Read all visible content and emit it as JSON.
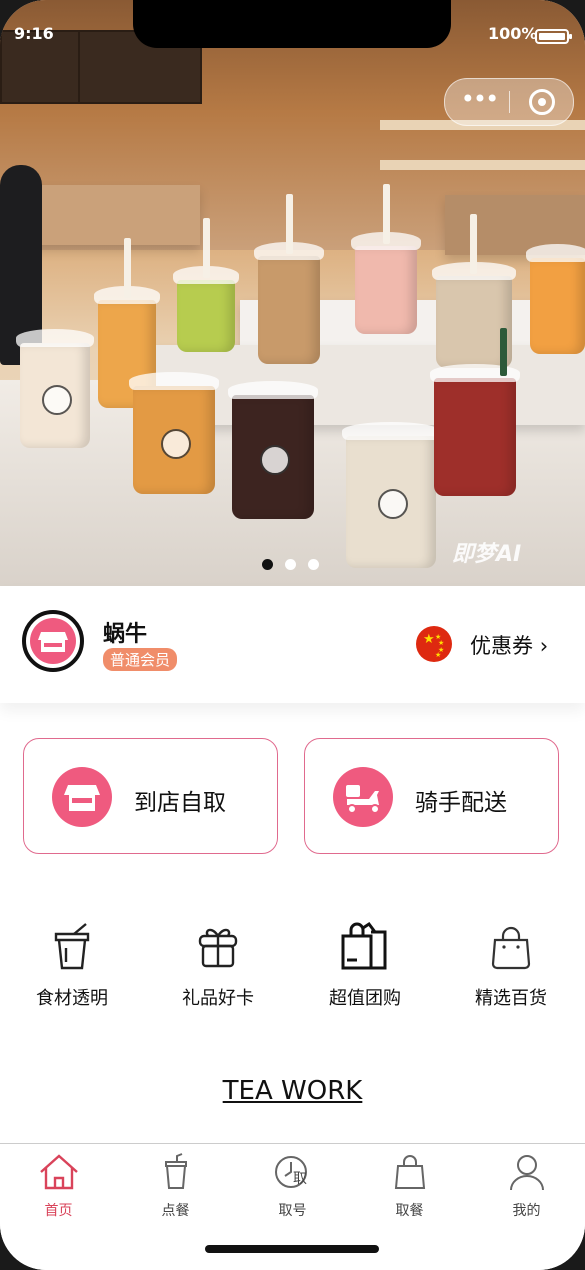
{
  "status_bar": {
    "time": "9:16",
    "battery": "100%",
    "battery_level": 1.0
  },
  "banner": {
    "watermark": "即梦AI",
    "slide_count": 3,
    "active_slide": 1
  },
  "member": {
    "name": "蜗牛",
    "level": "普通会员",
    "coupon_label": "优惠券",
    "chevron": "›"
  },
  "order_options": [
    {
      "label": "到店自取",
      "icon": "store-icon"
    },
    {
      "label": "骑手配送",
      "icon": "scooter-icon"
    }
  ],
  "services": [
    {
      "label": "食材透明",
      "icon": "cup-icon"
    },
    {
      "label": "礼品好卡",
      "icon": "gift-icon"
    },
    {
      "label": "超值团购",
      "icon": "shopping-bags-icon"
    },
    {
      "label": "精选百货",
      "icon": "handbag-icon"
    }
  ],
  "brand_link": "TEA WORK",
  "tabs": [
    {
      "label": "首页",
      "icon": "home-icon",
      "active": true
    },
    {
      "label": "点餐",
      "icon": "drink-cup-icon",
      "active": false
    },
    {
      "label": "取号",
      "icon": "clock-ticket-icon",
      "active": false
    },
    {
      "label": "取餐",
      "icon": "bag-icon",
      "active": false
    },
    {
      "label": "我的",
      "icon": "user-icon",
      "active": false
    }
  ],
  "colors": {
    "accent": "#ef5a7f",
    "tab_active": "#d9435a",
    "level_badge": "#f08d6a",
    "card_border": "#e06a8e"
  }
}
